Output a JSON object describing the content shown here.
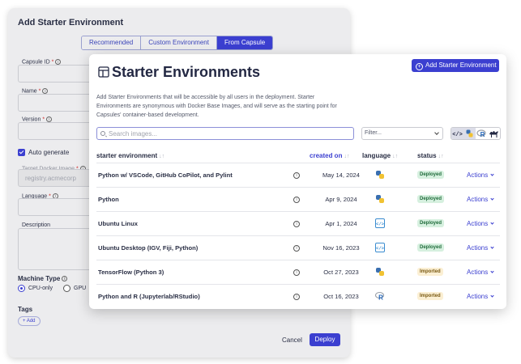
{
  "back_dialog": {
    "title": "Add Starter Environment",
    "tabs": [
      "Recommended",
      "Custom Environment",
      "From Capsule"
    ],
    "fields": {
      "capsule_id": "Capsule ID",
      "name": "Name",
      "version": "Version",
      "auto_generate": "Auto generate",
      "target_docker_image": "Target Docker Image",
      "target_docker_placeholder": "registry.acmecorp",
      "language": "Language",
      "description": "Description",
      "required_mark": "*",
      "info_glyph": "i"
    },
    "machine_type": {
      "label": "Machine Type",
      "options": [
        "CPU-only",
        "GPU"
      ],
      "selected": "CPU-only"
    },
    "tags": {
      "label": "Tags",
      "add_label": "+ Add"
    },
    "cancel_label": "Cancel",
    "deploy_label": "Deploy"
  },
  "panel": {
    "title": "Starter Environments",
    "add_button_label": "Add Starter Environment",
    "add_button_icon": "+",
    "description": "Add Starter Environments that will be accessible by all users in the deployment. Starter Environments are synonymous with Docker Base Images, and will serve as the starting point for Capsules' container-based development.",
    "search_placeholder": "Search images...",
    "filter_label": "Filter...",
    "language_toggle_icons": [
      "code-icon",
      "python-icon",
      "r-icon",
      "camel-icon"
    ],
    "columns": {
      "name": "starter environment",
      "created": "created on",
      "language": "language",
      "status": "status",
      "sort_glyph": "↓↑"
    },
    "rows": [
      {
        "name": "Python w/ VSCode, GitHub CoPilot, and Pylint",
        "date": "May 14, 2024",
        "lang": "python-icon",
        "status": "Deployed",
        "action": "Actions",
        "info": "i"
      },
      {
        "name": "Python",
        "date": "Apr 9, 2024",
        "lang": "python-icon",
        "status": "Deployed",
        "action": "Actions",
        "info": "i"
      },
      {
        "name": "Ubuntu Linux",
        "date": "Apr 1, 2024",
        "lang": "code-icon",
        "status": "Deployed",
        "action": "Actions",
        "info": "i"
      },
      {
        "name": "Ubuntu Desktop (IGV, Fiji, Python)",
        "date": "Nov 16, 2023",
        "lang": "code-icon",
        "status": "Deployed",
        "action": "Actions",
        "info": "i"
      },
      {
        "name": "TensorFlow (Python 3)",
        "date": "Oct 27, 2023",
        "lang": "python-icon",
        "status": "Imported",
        "action": "Actions",
        "info": "i"
      },
      {
        "name": "Python and R (Jupyterlab/RStudio)",
        "date": "Oct 16, 2023",
        "lang": "r-icon",
        "status": "Imported",
        "action": "Actions",
        "info": "i"
      }
    ]
  },
  "colors": {
    "accent": "#3b3fd0",
    "deployed_bg": "#d6f0df",
    "imported_bg": "#fbefd3"
  }
}
